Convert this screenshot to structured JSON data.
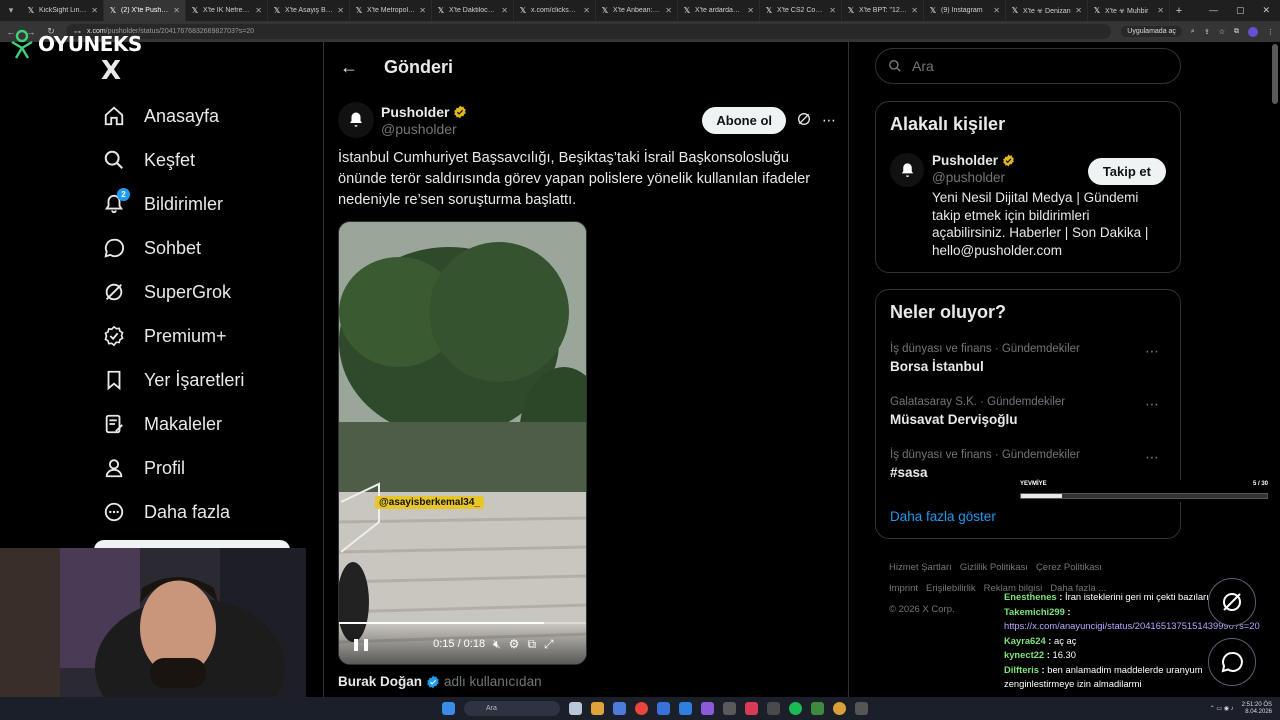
{
  "browser": {
    "tabs": [
      {
        "title": "KickSight Link De",
        "active": false
      },
      {
        "title": "(2) X'te Pusholde",
        "active": true
      },
      {
        "title": "X'te İK Nefretli \"",
        "active": false
      },
      {
        "title": "X'te Asayiş Berke",
        "active": false
      },
      {
        "title": "X'te Metropol Ha",
        "active": false
      },
      {
        "title": "X'te Daktilocb: \"B",
        "active": false
      },
      {
        "title": "x.com/clickshab",
        "active": false
      },
      {
        "title": "X'te Anbean: \"An",
        "active": false
      },
      {
        "title": "X'te ardardavi: \"n",
        "active": false
      },
      {
        "title": "X'te CS2 Commu",
        "active": false
      },
      {
        "title": "X'te BPT: \"12 ton",
        "active": false
      },
      {
        "title": "(9) Instagram",
        "active": false
      },
      {
        "title": "X'te ☣ Denizan",
        "active": false
      },
      {
        "title": "X'te ☣ Muhbir",
        "active": false
      }
    ],
    "url_host": "x.com",
    "url_path": "/pusholder/status/2041767683266982703?s=20",
    "open_in_app": "Uygulamada aç"
  },
  "overlay_logo": {
    "text": "OYUNEKS"
  },
  "x_logo": "X",
  "sidebar": {
    "items": [
      {
        "label": "Anasayfa",
        "icon": "home-icon"
      },
      {
        "label": "Keşfet",
        "icon": "search-icon"
      },
      {
        "label": "Bildirimler",
        "icon": "bell-icon",
        "badge": "2"
      },
      {
        "label": "Sohbet",
        "icon": "chat-icon"
      },
      {
        "label": "SuperGrok",
        "icon": "grok-icon"
      },
      {
        "label": "Premium+",
        "icon": "verified-icon"
      },
      {
        "label": "Yer İşaretleri",
        "icon": "bookmark-icon"
      },
      {
        "label": "Makaleler",
        "icon": "article-icon"
      },
      {
        "label": "Profil",
        "icon": "person-icon"
      },
      {
        "label": "Daha fazla",
        "icon": "more-circle-icon"
      }
    ]
  },
  "post": {
    "header_title": "Gönderi",
    "author_name": "Pusholder",
    "author_handle": "@pusholder",
    "subscribe_label": "Abone ol",
    "text": "İstanbul Cumhuriyet Başsavcılığı, Beşiktaş’taki İsrail Başkonsolosluğu önünde terör saldırısında görev yapan polislere yönelik kullanılan ifadeler nedeniyle re’sen soruşturma başlattı.",
    "video": {
      "overlay_tag": "@asayisberkemal34_",
      "time": "0:15 / 0:18",
      "progress": 0.83
    },
    "reposter_name": "Burak Doğan",
    "reposter_suffix": "adlı kullanıcıdan"
  },
  "right": {
    "search_placeholder": "Ara",
    "related": {
      "title": "Alakalı kişiler",
      "name": "Pusholder",
      "handle": "@pusholder",
      "follow_label": "Takip et",
      "bio": "Yeni Nesil Dijital Medya | Gündemi takip etmek için bildirimleri açabilirsiniz. Haberler | Son Dakika | hello@pusholder.com"
    },
    "trends": {
      "title": "Neler oluyor?",
      "items": [
        {
          "meta": "İş dünyası ve finans · Gündemdekiler",
          "title": "Borsa İstanbul"
        },
        {
          "meta": "Galatasaray S.K. · Gündemdekiler",
          "title": "Müsavat Dervişoğlu"
        },
        {
          "meta": "İş dünyası ve finans · Gündemdekiler",
          "title": "#sasa"
        }
      ],
      "show_more": "Daha fazla göster"
    },
    "footer": {
      "links": [
        "Hizmet Şartları",
        "Gizlilik Politikası",
        "Çerez Politikası",
        "Imprint",
        "Erişilebilirlik",
        "Reklam bilgisi",
        "Daha fazla ..."
      ],
      "copyright": "© 2026 X Corp."
    }
  },
  "stream": {
    "yevmiye_label": "YEVMİYE",
    "yevmiye_count": "5 / 30",
    "yevmiye_progress": 0.1667,
    "chat": [
      {
        "user": "Enesthenes",
        "msg": "İran isteklerini geri mi çekti bazılarını"
      },
      {
        "user": "Takemichi299",
        "msg": "https://x.com/anayuncigi/status/2041651375151439990?s=20",
        "link": true
      },
      {
        "user": "Kayra624",
        "msg": "aç aç"
      },
      {
        "user": "kynect22",
        "msg": "16.30"
      },
      {
        "user": "Dilfteris",
        "msg": "ben anlamadim maddelerde uranyum zenginlestirmeye izin almadilarmi"
      }
    ]
  },
  "taskbar": {
    "search_label": "Ara",
    "time": "2:51:20 ÖS",
    "date": "8.04.2026"
  },
  "colors": {
    "accent": "#1d9bf0",
    "verified_gold": "#e2b719",
    "background": "#000000",
    "border": "#2f3336",
    "muted": "#71767b"
  }
}
